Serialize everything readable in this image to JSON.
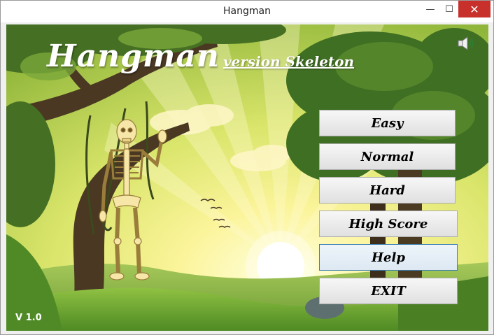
{
  "window": {
    "title": "Hangman",
    "minimize_glyph": "—",
    "maximize_glyph": "☐",
    "close_glyph": "✕"
  },
  "header": {
    "title": "Hangman",
    "subtitle": "version Skeleton"
  },
  "menu": {
    "easy": "Easy",
    "normal": "Normal",
    "hard": "Hard",
    "high_score": "High Score",
    "help": "Help",
    "exit": "EXIT"
  },
  "footer": {
    "version": "V 1.0"
  },
  "icons": {
    "sound": "speaker-icon",
    "character": "skeleton-icon"
  },
  "colors": {
    "sky_glow": "#fff9b8",
    "sky_mid": "#c8dc5a",
    "tree_green": "#4f7d2a",
    "ground_green": "#6fa233",
    "close_red": "#c7302b",
    "help_focus_border": "#3c7fb1"
  }
}
